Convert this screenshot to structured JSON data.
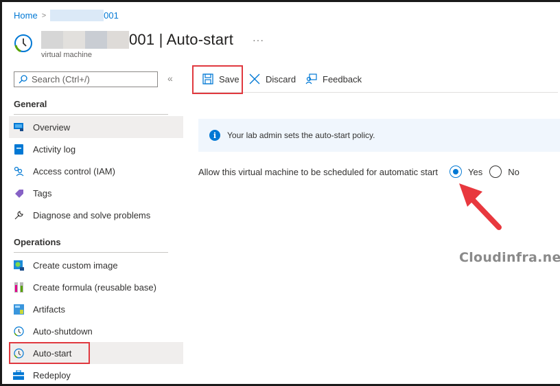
{
  "breadcrumb": {
    "home": "Home",
    "resource_suffix": "001"
  },
  "header": {
    "title": "001 | Auto-start",
    "subtitle": "virtual machine",
    "more_label": "···"
  },
  "sidebar": {
    "search_placeholder": "Search (Ctrl+/)",
    "collapse_label": "«",
    "sections": [
      {
        "heading": "General",
        "items": [
          {
            "label": "Overview",
            "icon": "monitor-icon"
          },
          {
            "label": "Activity log",
            "icon": "activity-log-icon"
          },
          {
            "label": "Access control (IAM)",
            "icon": "people-icon"
          },
          {
            "label": "Tags",
            "icon": "tag-icon"
          },
          {
            "label": "Diagnose and solve problems",
            "icon": "wrench-icon"
          }
        ]
      },
      {
        "heading": "Operations",
        "items": [
          {
            "label": "Create custom image",
            "icon": "custom-image-icon"
          },
          {
            "label": "Create formula (reusable base)",
            "icon": "test-tubes-icon"
          },
          {
            "label": "Artifacts",
            "icon": "artifacts-icon"
          },
          {
            "label": "Auto-shutdown",
            "icon": "clock-icon"
          },
          {
            "label": "Auto-start",
            "icon": "clock-icon",
            "selected": true
          },
          {
            "label": "Redeploy",
            "icon": "toolbox-icon"
          }
        ]
      }
    ]
  },
  "toolbar": {
    "save_label": "Save",
    "discard_label": "Discard",
    "feedback_label": "Feedback"
  },
  "info_bar": {
    "message": "Your lab admin sets the auto-start policy."
  },
  "form": {
    "label": "Allow this virtual machine to be scheduled for automatic start",
    "options": [
      "Yes",
      "No"
    ],
    "selected": "Yes"
  },
  "watermark": "Cloudinfra.net",
  "colors": {
    "accent": "#0078d4",
    "highlight_box": "#e0383e",
    "info_bg": "#f0f6fd"
  }
}
